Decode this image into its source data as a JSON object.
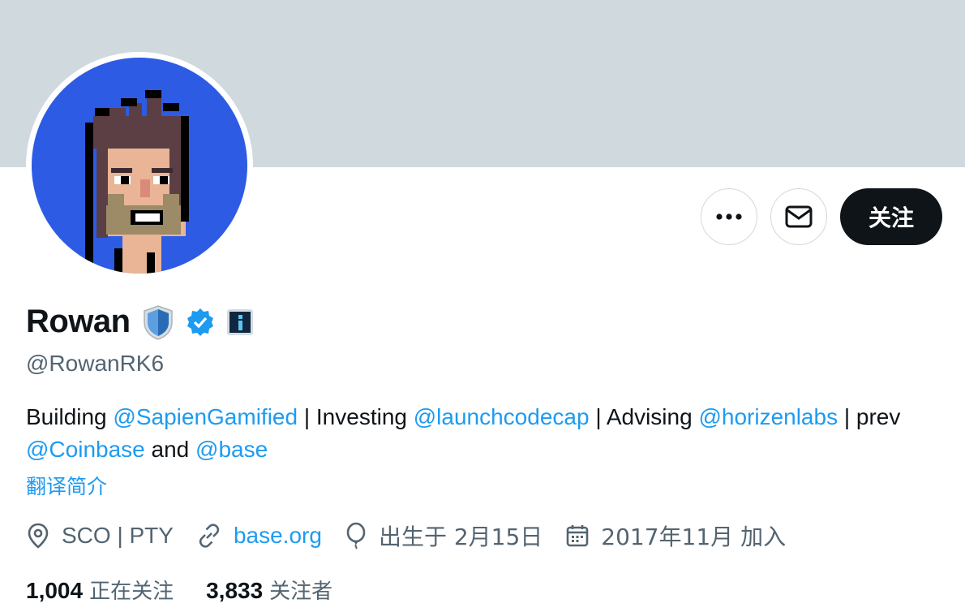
{
  "profile": {
    "display_name": "Rowan",
    "handle": "@RowanRK6",
    "bio": {
      "t1": "Building ",
      "m1": "@SapienGamified",
      "t2": " | Investing ",
      "m2": "@launchcodecap",
      "t3": " | Advising ",
      "m3": "@horizenlabs",
      "t4": " | prev ",
      "m4": "@Coinbase",
      "t5": " and ",
      "m5": "@base"
    },
    "translate_label": "翻译简介",
    "location": "SCO | PTY",
    "website": "base.org",
    "birthday": "出生于 2月15日",
    "joined": "2017年11月 加入"
  },
  "actions": {
    "follow_label": "关注"
  },
  "stats": {
    "following_count": "1,004",
    "following_label": "正在关注",
    "followers_count": "3,833",
    "followers_label": "关注者"
  },
  "colors": {
    "banner": "#cfd9de",
    "link": "#1d9bf0",
    "avatar_bg": "#2d5be3",
    "follow_button": "#0f1419",
    "verified": "#1d9bf0"
  },
  "icons": {
    "more": "more-icon",
    "message": "message-icon",
    "shield": "shield-icon",
    "verified": "verified-badge-icon",
    "affiliate": "affiliate-badge-icon",
    "location": "location-icon",
    "link": "link-icon",
    "birthday": "balloon-icon",
    "calendar": "calendar-icon"
  }
}
